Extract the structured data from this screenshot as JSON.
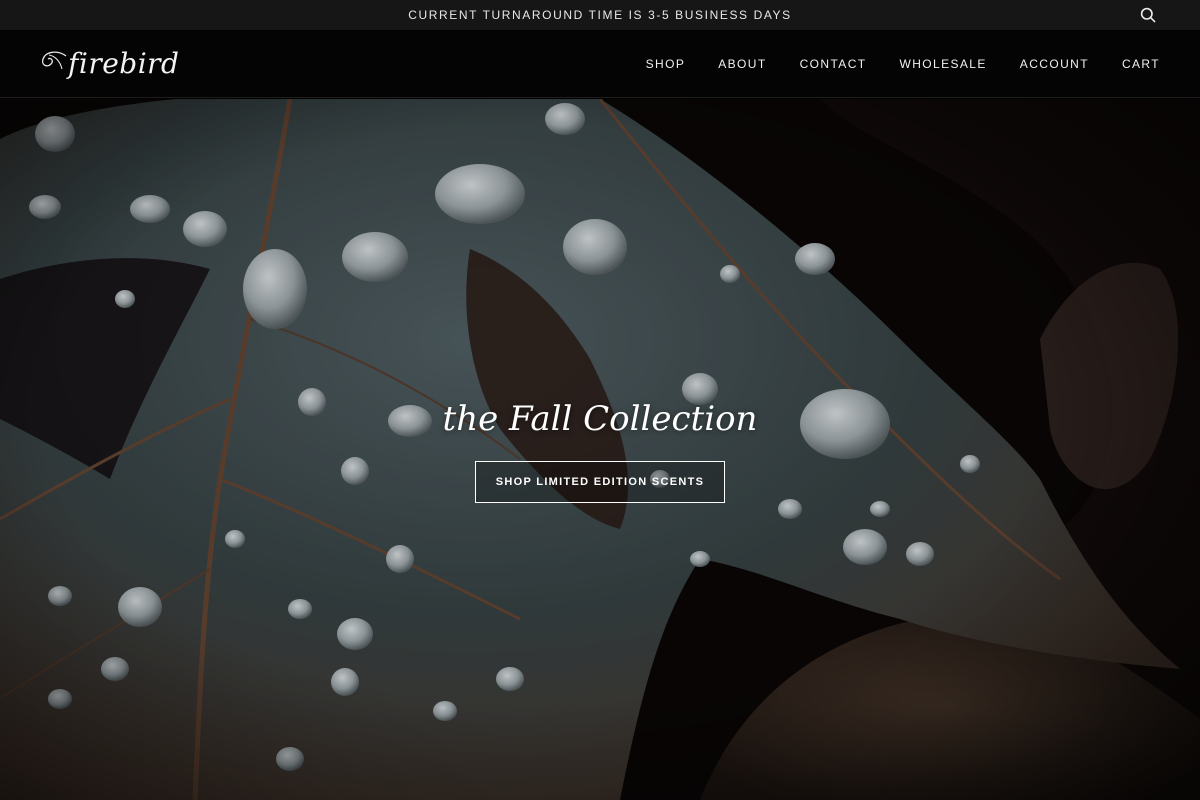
{
  "announcement": {
    "text": "CURRENT TURNAROUND TIME IS 3-5 BUSINESS DAYS",
    "search_icon": "search-icon"
  },
  "header": {
    "logo_text": "firebird",
    "logo_icon": "feather-swirl-icon",
    "nav": {
      "shop": "SHOP",
      "about": "ABOUT",
      "contact": "CONTACT",
      "wholesale": "WHOLESALE",
      "account": "ACCOUNT",
      "cart": "CART"
    }
  },
  "hero": {
    "title": "the Fall Collection",
    "cta_label": "SHOP LIMITED EDITION SCENTS",
    "background": "dark autumn leaf with water droplets"
  },
  "colors": {
    "announcement_bg": "#161616",
    "header_bg": "#040404",
    "text": "#ffffff",
    "leaf_teal": "#3b4a4c",
    "leaf_brown": "#6a4a36"
  }
}
